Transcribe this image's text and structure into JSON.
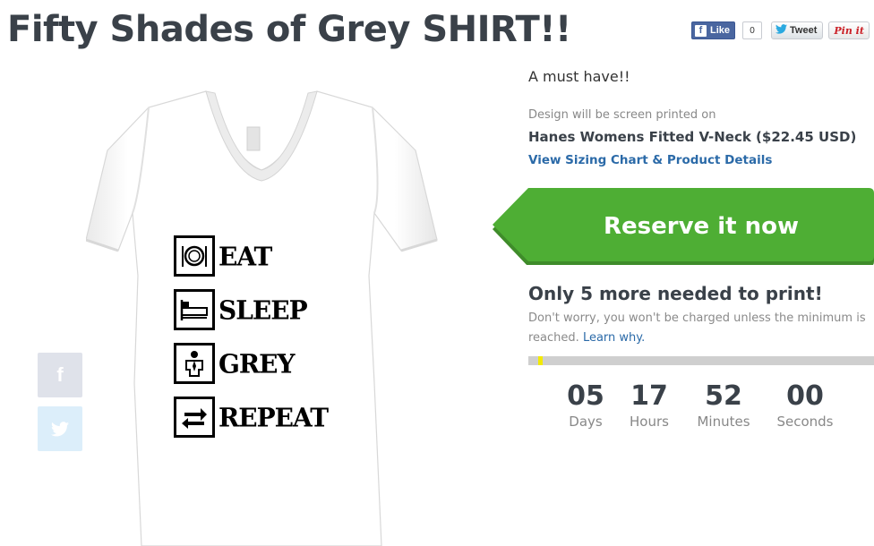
{
  "title": "Fifty Shades of Grey SHIRT!!",
  "share": {
    "fb_like_label": "Like",
    "fb_count": "0",
    "tweet_label": "Tweet",
    "pin_label": "Pin it"
  },
  "side_social": {
    "facebook_glyph": "f",
    "twitter_icon": "twitter-bird-icon"
  },
  "shirt": {
    "lines": [
      "EAT",
      "SLEEP",
      "GREY",
      "REPEAT"
    ],
    "icons": [
      "plate-fork-knife-icon",
      "bed-icon",
      "man-in-suit-icon",
      "arrows-swap-icon"
    ]
  },
  "product": {
    "tagline": "A must have!!",
    "design_note": "Design will be screen printed on",
    "name": "Hanes Womens Fitted V-Neck ($22.45 USD)",
    "sizing_link": "View Sizing Chart & Product Details"
  },
  "reserve": {
    "label": "Reserve it now",
    "color": "#4eae34",
    "shadow_color": "#3f8c2a"
  },
  "campaign": {
    "needed": "Only 5 more needed to print!",
    "charge_note": "Don't worry, you won't be charged unless the minimum is reached.",
    "learn_link": "Learn why.",
    "progress_fraction": 0.03
  },
  "countdown": [
    {
      "value": "05",
      "label": "Days"
    },
    {
      "value": "17",
      "label": "Hours"
    },
    {
      "value": "52",
      "label": "Minutes"
    },
    {
      "value": "00",
      "label": "Seconds"
    }
  ]
}
